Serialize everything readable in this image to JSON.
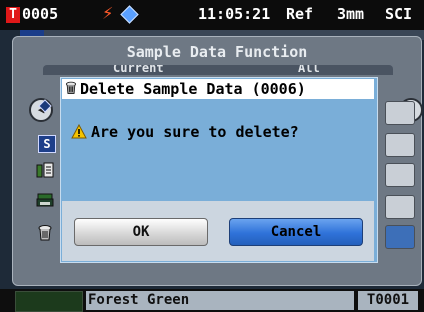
{
  "status": {
    "badge": "T",
    "number": "0005",
    "bolt_icon": "⚡",
    "time": "11:05:21",
    "ref": "Ref",
    "aperture": "3mm",
    "mode": "SCI"
  },
  "background_panel": {
    "title": "Sample Data Function",
    "tab_left": "Current",
    "tab_right": "All",
    "nav_left_icon": "◀",
    "nav_right_icon": "▶",
    "side_icons": [
      "tag-icon",
      "s-icon",
      "files-icon",
      "printer-icon",
      "trash-icon"
    ]
  },
  "dialog": {
    "title_icon": "🗑",
    "title": "Delete Sample Data (0006)",
    "warning_icon": "⚠",
    "message": "Are you sure to delete?",
    "ok_label": "OK",
    "cancel_label": "Cancel"
  },
  "bottom": {
    "sample_name": "Forest Green",
    "target_id": "T0001"
  },
  "colors": {
    "dialog_bg": "#7aaed8",
    "cancel_button": "#2f72d9",
    "badge_red": "#e01818",
    "swatch": "#1c3a1c"
  }
}
